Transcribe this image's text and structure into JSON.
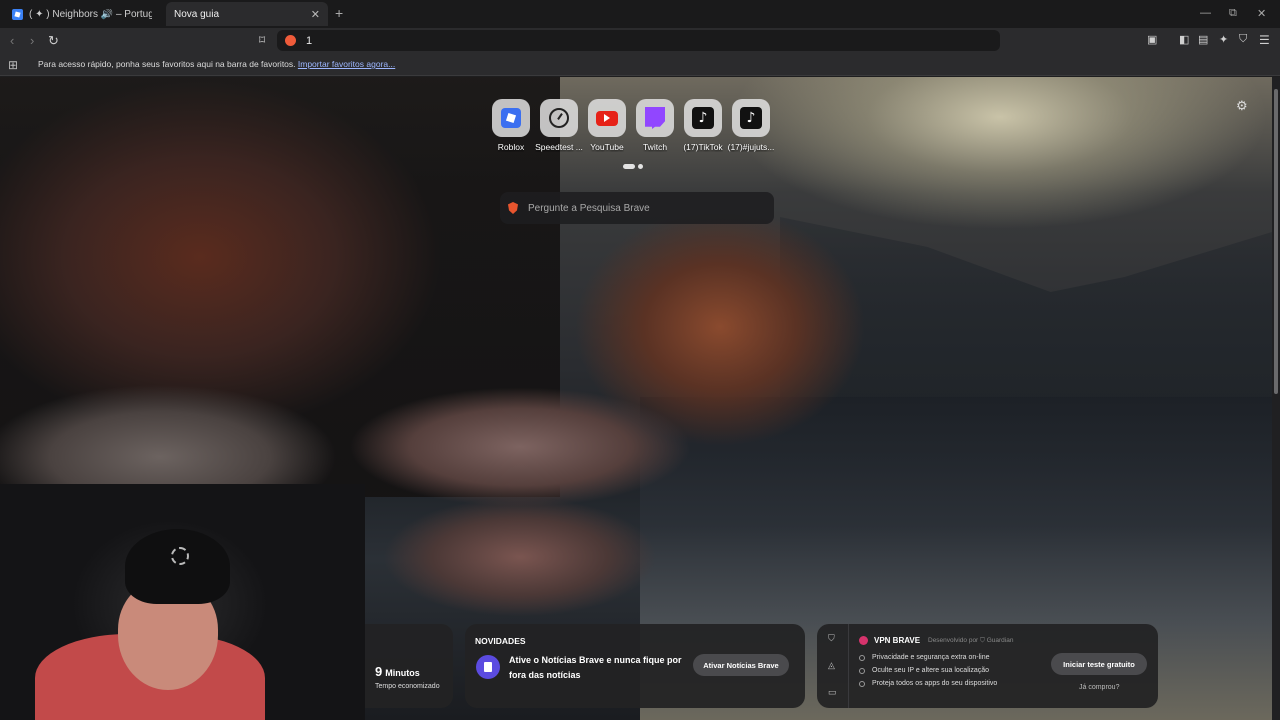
{
  "tabs": [
    {
      "title": "( ✦ ) Neighbors 🔊 – Português - Roblox",
      "favicon": "roblox-icon"
    },
    {
      "title": "Nova guia",
      "close": "✕"
    }
  ],
  "new_tab_glyph": "+",
  "window_controls": {
    "minimize": "—",
    "restore": "⧉",
    "close": "✕"
  },
  "address_bar": {
    "value": "1"
  },
  "bookmarks_bar": {
    "message": "Para acesso rápido, ponha seus favoritos aqui na barra de favoritos.",
    "import_link": "Importar favoritos agora..."
  },
  "top_sites": [
    {
      "label": "Roblox",
      "icon": "roblox-icon"
    },
    {
      "label": "Speedtest ...",
      "icon": "speedtest-icon"
    },
    {
      "label": "YouTube",
      "icon": "youtube-icon"
    },
    {
      "label": "Twitch",
      "icon": "twitch-icon"
    },
    {
      "label": "(17)TikTok",
      "icon": "tiktok-icon"
    },
    {
      "label": "(17)#jujuts...",
      "icon": "tiktok-icon"
    }
  ],
  "search": {
    "placeholder": "Pergunte a Pesquisa Brave"
  },
  "stats": {
    "value": "9",
    "unit": "Minutos",
    "caption": "Tempo economizado"
  },
  "news": {
    "header": "NOVIDADES",
    "message": "Ative o Notícias Brave e nunca fique por fora das notícias",
    "button": "Ativar Notícias Brave"
  },
  "vpn": {
    "title": "VPN BRAVE",
    "developed_by": "Desenvolvido por ⛉ Guardian",
    "features": [
      "Privacidade e segurança extra on-line",
      "Oculte seu IP e altere sua localização",
      "Proteja todos os apps do seu dispositivo"
    ],
    "button": "Iniciar teste gratuito",
    "already_bought": "Já comprou?"
  },
  "colors": {
    "accent_news": "#5b4be0",
    "brave_orange": "#e8552e",
    "youtube_red": "#e62117",
    "twitch_purple": "#9146ff"
  }
}
